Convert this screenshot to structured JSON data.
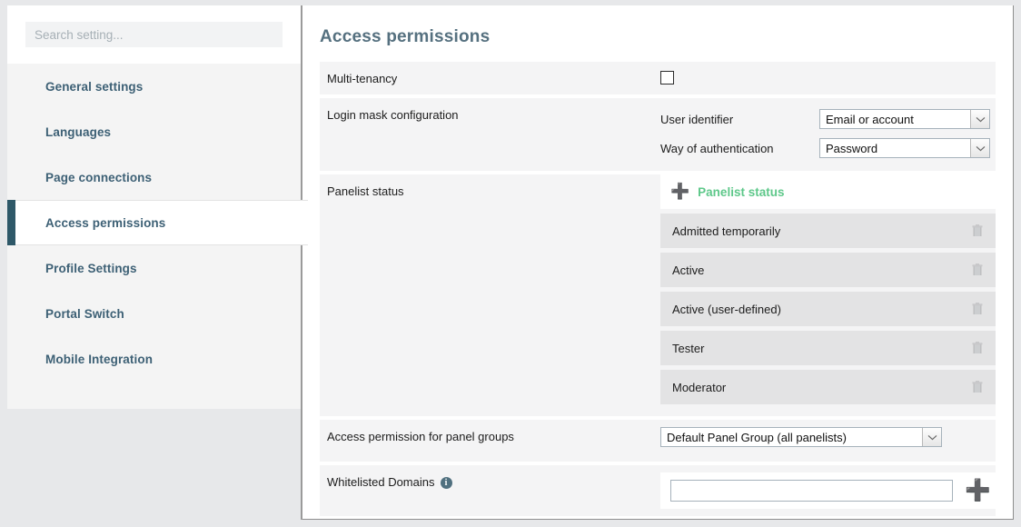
{
  "sidebar": {
    "search": {
      "placeholder": "Search setting...",
      "value": ""
    },
    "items": [
      {
        "label": "General settings",
        "active": false
      },
      {
        "label": "Languages",
        "active": false
      },
      {
        "label": "Page connections",
        "active": false
      },
      {
        "label": "Access permissions",
        "active": true
      },
      {
        "label": "Profile Settings",
        "active": false
      },
      {
        "label": "Portal Switch",
        "active": false
      },
      {
        "label": "Mobile Integration",
        "active": false
      }
    ]
  },
  "main": {
    "title": "Access permissions",
    "multi_tenancy": {
      "label": "Multi-tenancy",
      "checked": false
    },
    "login_mask": {
      "label": "Login mask configuration",
      "user_identifier": {
        "label": "User identifier",
        "value": "Email or account"
      },
      "way_of_authentication": {
        "label": "Way of authentication",
        "value": "Password"
      }
    },
    "panelist_status": {
      "label": "Panelist status",
      "add_label": "Panelist status",
      "items": [
        "Admitted temporarily",
        "Active",
        "Active (user-defined)",
        "Tester",
        "Moderator"
      ]
    },
    "panel_groups": {
      "label": "Access permission for panel groups",
      "value": "Default Panel Group (all panelists)"
    },
    "whitelisted_domains": {
      "label": "Whitelisted Domains",
      "info_glyph": "i",
      "value": "",
      "placeholder": ""
    }
  },
  "colors": {
    "accent_teal": "#2e5868",
    "nav_text": "#3d6075",
    "green": "#5ec88a",
    "green_bright": "#35cc6c",
    "row_bg": "#f4f4f5",
    "status_bg": "#e3e3e4"
  }
}
